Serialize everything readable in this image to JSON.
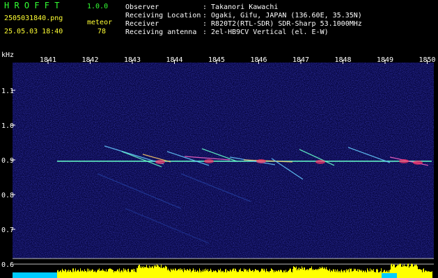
{
  "app": {
    "title": "H R O F F T",
    "version": "1.0.0"
  },
  "file": {
    "name": "2505031840.png",
    "datetime": "25.05.03 18:40"
  },
  "meteor": {
    "label": "meteor",
    "count": "78"
  },
  "info": [
    {
      "label": "Observer",
      "value": ": Takanori Kawachi"
    },
    {
      "label": "Receiving Location",
      "value": ": Ogaki, Gifu, JAPAN (136.60E, 35.35N)"
    },
    {
      "label": "Receiver",
      "value": ": R820T2(RTL-SDR) SDR-Sharp 53.1000MHz"
    },
    {
      "label": "Receiving antenna",
      "value": ": 2el-HB9CV Vertical (el. E-W)"
    }
  ],
  "axis": {
    "y_unit": "kHz",
    "x_ticks": [
      "1841",
      "1842",
      "1843",
      "1844",
      "1845",
      "1846",
      "1847",
      "1848",
      "1849",
      "1850"
    ],
    "y_ticks": [
      "1.1",
      "1.0",
      "0.9",
      "0.8",
      "0.7",
      "0.6"
    ]
  },
  "colors": {
    "text_white": "#ffffff",
    "text_yellow": "#ffff33",
    "title_green": "#33ff33",
    "background": "#000000",
    "noise": "#1a1a8c",
    "carrier": "#66ffcc",
    "level_yellow": "#ffff00",
    "level_cyan": "#00ccff"
  }
}
